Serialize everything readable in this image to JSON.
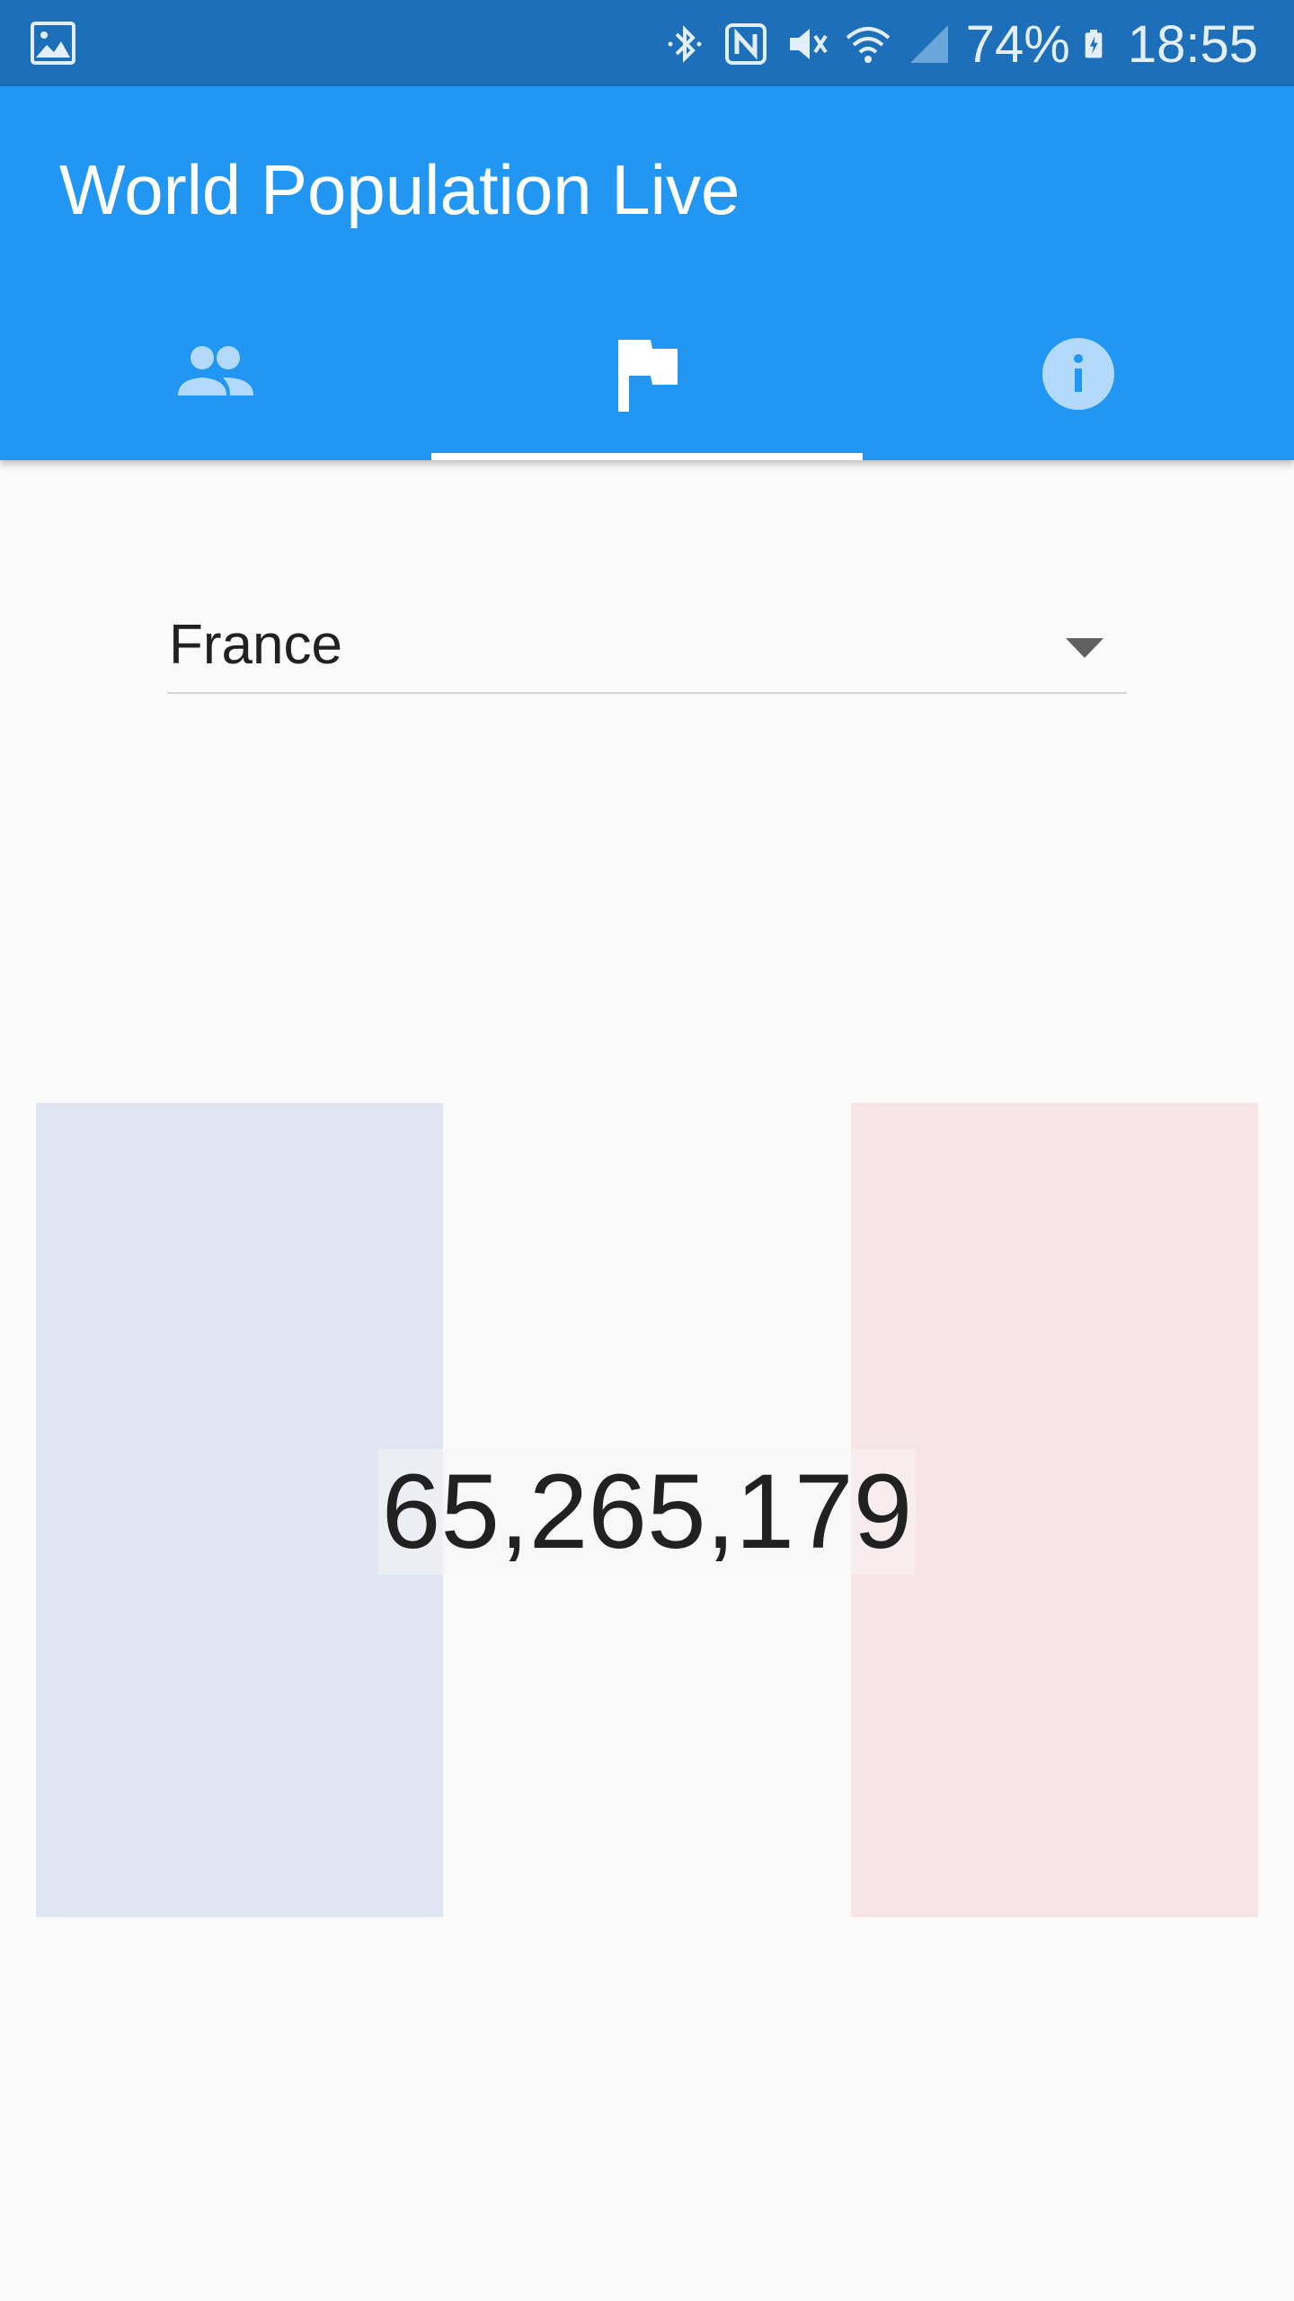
{
  "status_bar": {
    "battery_percent": "74%",
    "time": "18:55",
    "icons": [
      "gallery-icon",
      "bluetooth-icon",
      "nfc-icon",
      "mute-icon",
      "wifi-icon",
      "signal-icon",
      "battery-charging-icon"
    ],
    "color": "#1c6fb8"
  },
  "app_bar": {
    "title": "World Population Live",
    "color": "#2196f3",
    "tabs": [
      {
        "icon": "people-icon",
        "selected": false
      },
      {
        "icon": "flag-icon",
        "selected": true
      },
      {
        "icon": "info-icon",
        "selected": false
      }
    ]
  },
  "country_selector": {
    "selected": "France"
  },
  "flag": {
    "country": "France",
    "stripes": [
      "#e1e5f1",
      "#fafafa",
      "#f8e3e6"
    ]
  },
  "population": {
    "value": "65,265,179"
  }
}
